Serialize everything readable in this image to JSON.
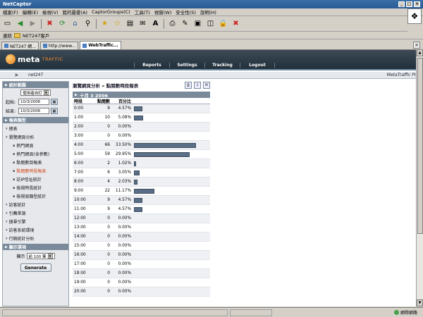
{
  "window": {
    "title": "NetCaptor"
  },
  "menu": [
    "檔案(F)",
    "編輯(E)",
    "檢視(V)",
    "我的最愛(A)",
    "CaptorGroups(C)",
    "工具(T)",
    "視窗(W)",
    "安全性(S)",
    "說明(H)"
  ],
  "toolbar_icons": [
    "new-icon",
    "back-icon",
    "forward-icon",
    "stop-icon",
    "refresh-icon",
    "home-icon",
    "search-icon",
    "favorites-icon",
    "add-favorite-icon",
    "history-icon",
    "mail-icon",
    "font-icon",
    "print-icon",
    "edit-icon",
    "window-icon",
    "tile-icon",
    "lock-icon",
    "close-icon"
  ],
  "address": {
    "label": "連結",
    "link": "NET247客戶"
  },
  "tabs": [
    {
      "label": "NET247 網..."
    },
    {
      "label": "http://www..."
    },
    {
      "label": "WebTraffic..."
    }
  ],
  "app": {
    "logo_text": "meta",
    "logo_text2": "TRAFFIC",
    "nav": [
      "Reports",
      "Settings",
      "Tracking",
      "Logout"
    ],
    "site": "net247",
    "product": "MetaTraffic Pro"
  },
  "sidebar": {
    "stats_range_title": "統計範圍",
    "usage_select": "使用者自訂",
    "start_label": "起始:",
    "start_value": "10/3/2006",
    "end_label": "結束:",
    "end_value": "10/3/2006",
    "reports_title": "報表類型",
    "reports": [
      {
        "label": "總表",
        "level": 0,
        "active": false
      },
      {
        "label": "瀏覽網頁分析",
        "level": 0,
        "active": false
      },
      {
        "label": "熱門網頁",
        "level": 1,
        "active": false
      },
      {
        "label": "熱門網頁(含參數)",
        "level": 1,
        "active": false
      },
      {
        "label": "點閱數目報表",
        "level": 1,
        "active": false
      },
      {
        "label": "點閱數時段報表",
        "level": 1,
        "active": true
      },
      {
        "label": "訪IP信址統計",
        "level": 1,
        "active": false
      },
      {
        "label": "檢視時長統計",
        "level": 1,
        "active": false
      },
      {
        "label": "檢視頁類型統計",
        "level": 1,
        "active": false
      },
      {
        "label": "訪客統計",
        "level": 0,
        "active": false
      },
      {
        "label": "引薦來源",
        "level": 0,
        "active": false
      },
      {
        "label": "搜尋引擎",
        "level": 0,
        "active": false
      },
      {
        "label": "訪客系統環境",
        "level": 0,
        "active": false
      },
      {
        "label": "行銷統計分析",
        "level": 0,
        "active": false
      }
    ],
    "display_title": "顯示選項",
    "display_label": "顯示",
    "display_value": "前 100 筆",
    "generate_label": "Generate"
  },
  "main": {
    "breadcrumb": "瀏覽網頁分析 » 點閱數時段報表",
    "date_header": "十月 3 2006",
    "columns": [
      "時段",
      "點閱數",
      "百分比"
    ],
    "rows": [
      {
        "time": "0:00",
        "hits": "9",
        "pct": "4.57%",
        "ratio": 0.0457
      },
      {
        "time": "1:00",
        "hits": "10",
        "pct": "5.08%",
        "ratio": 0.0508
      },
      {
        "time": "2:00",
        "hits": "0",
        "pct": "0.00%",
        "ratio": 0
      },
      {
        "time": "3:00",
        "hits": "0",
        "pct": "0.00%",
        "ratio": 0
      },
      {
        "time": "4:00",
        "hits": "66",
        "pct": "33.50%",
        "ratio": 0.335
      },
      {
        "time": "5:00",
        "hits": "59",
        "pct": "29.95%",
        "ratio": 0.2995
      },
      {
        "time": "6:00",
        "hits": "2",
        "pct": "1.02%",
        "ratio": 0.0102
      },
      {
        "time": "7:00",
        "hits": "6",
        "pct": "3.05%",
        "ratio": 0.0305
      },
      {
        "time": "8:00",
        "hits": "4",
        "pct": "2.03%",
        "ratio": 0.0203
      },
      {
        "time": "9:00",
        "hits": "22",
        "pct": "11.17%",
        "ratio": 0.1117
      },
      {
        "time": "10:00",
        "hits": "9",
        "pct": "4.57%",
        "ratio": 0.0457
      },
      {
        "time": "11:00",
        "hits": "9",
        "pct": "4.57%",
        "ratio": 0.0457
      },
      {
        "time": "12:00",
        "hits": "0",
        "pct": "0.00%",
        "ratio": 0
      },
      {
        "time": "13:00",
        "hits": "0",
        "pct": "0.00%",
        "ratio": 0
      },
      {
        "time": "14:00",
        "hits": "0",
        "pct": "0.00%",
        "ratio": 0
      },
      {
        "time": "15:00",
        "hits": "0",
        "pct": "0.00%",
        "ratio": 0
      },
      {
        "time": "16:00",
        "hits": "0",
        "pct": "0.00%",
        "ratio": 0
      },
      {
        "time": "17:00",
        "hits": "0",
        "pct": "0.00%",
        "ratio": 0
      },
      {
        "time": "18:00",
        "hits": "0",
        "pct": "0.00%",
        "ratio": 0
      },
      {
        "time": "19:00",
        "hits": "0",
        "pct": "0.00%",
        "ratio": 0
      },
      {
        "time": "20:00",
        "hits": "0",
        "pct": "0.00%",
        "ratio": 0
      }
    ]
  },
  "status": {
    "zone": "網際網路"
  },
  "colors": {
    "header_bg": "#2d3a46",
    "accent_orange": "#f08a2a",
    "section_head": "#7a8a9a",
    "bar": "#5a6e86",
    "active_link": "#d24a1a"
  }
}
